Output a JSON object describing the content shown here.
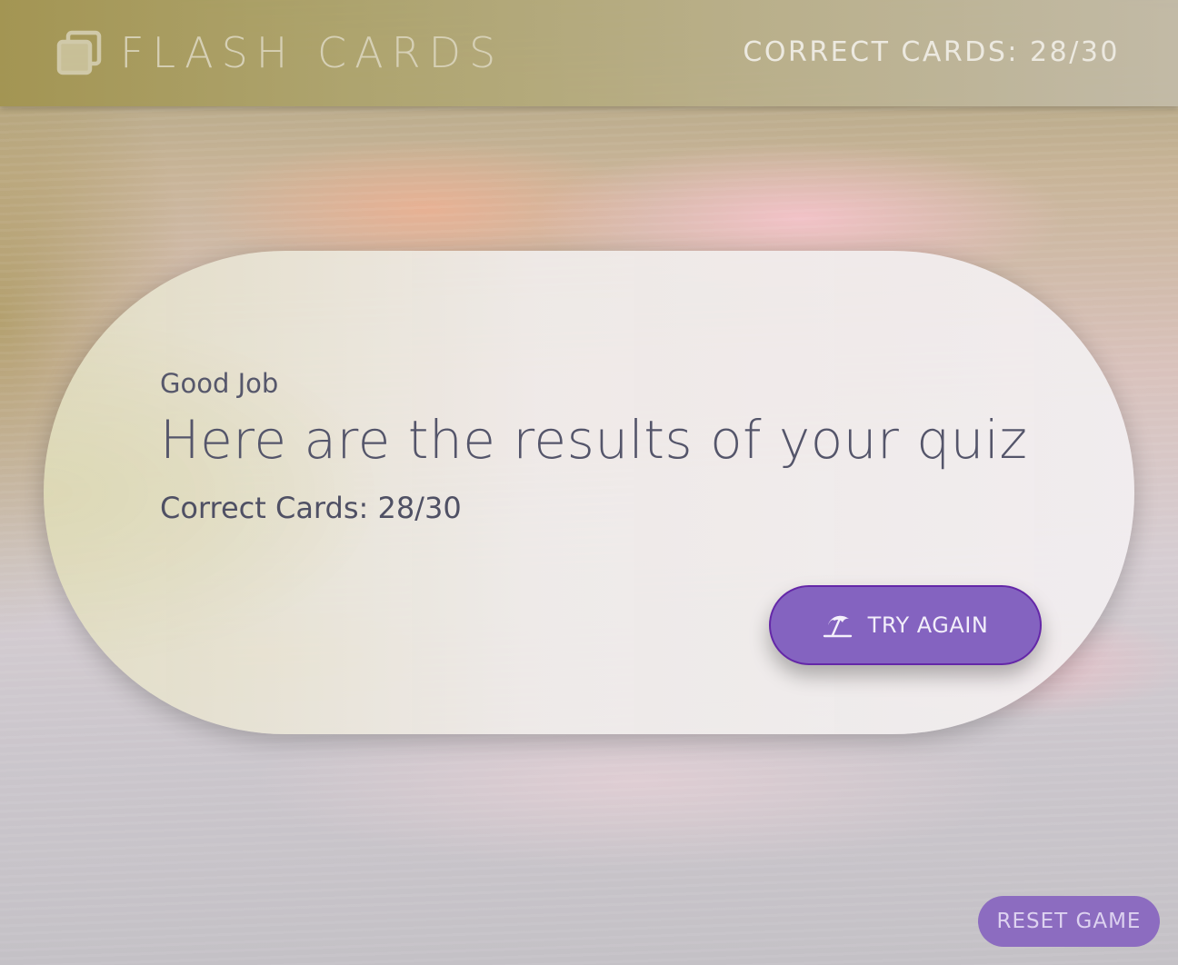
{
  "header": {
    "app_title": "FLASH CARDS",
    "app_icon": "stacked-cards-icon",
    "score_text": "CORRECT CARDS: 28/30"
  },
  "result_card": {
    "eyebrow": "Good Job",
    "headline": "Here are the results of your quiz",
    "score_text": "Correct Cards: 28/30",
    "try_again_button": {
      "label": "TRY AGAIN",
      "icon": "beach-umbrella-icon"
    }
  },
  "reset_button": {
    "label": "RESET GAME"
  },
  "score": {
    "correct": 28,
    "total": 30
  },
  "colors": {
    "header_bg": "#a89a5c",
    "button_primary": "#8463c0",
    "button_border": "#6427a8",
    "button_secondary": "#8c6cc0",
    "text_dark": "#55566a"
  }
}
